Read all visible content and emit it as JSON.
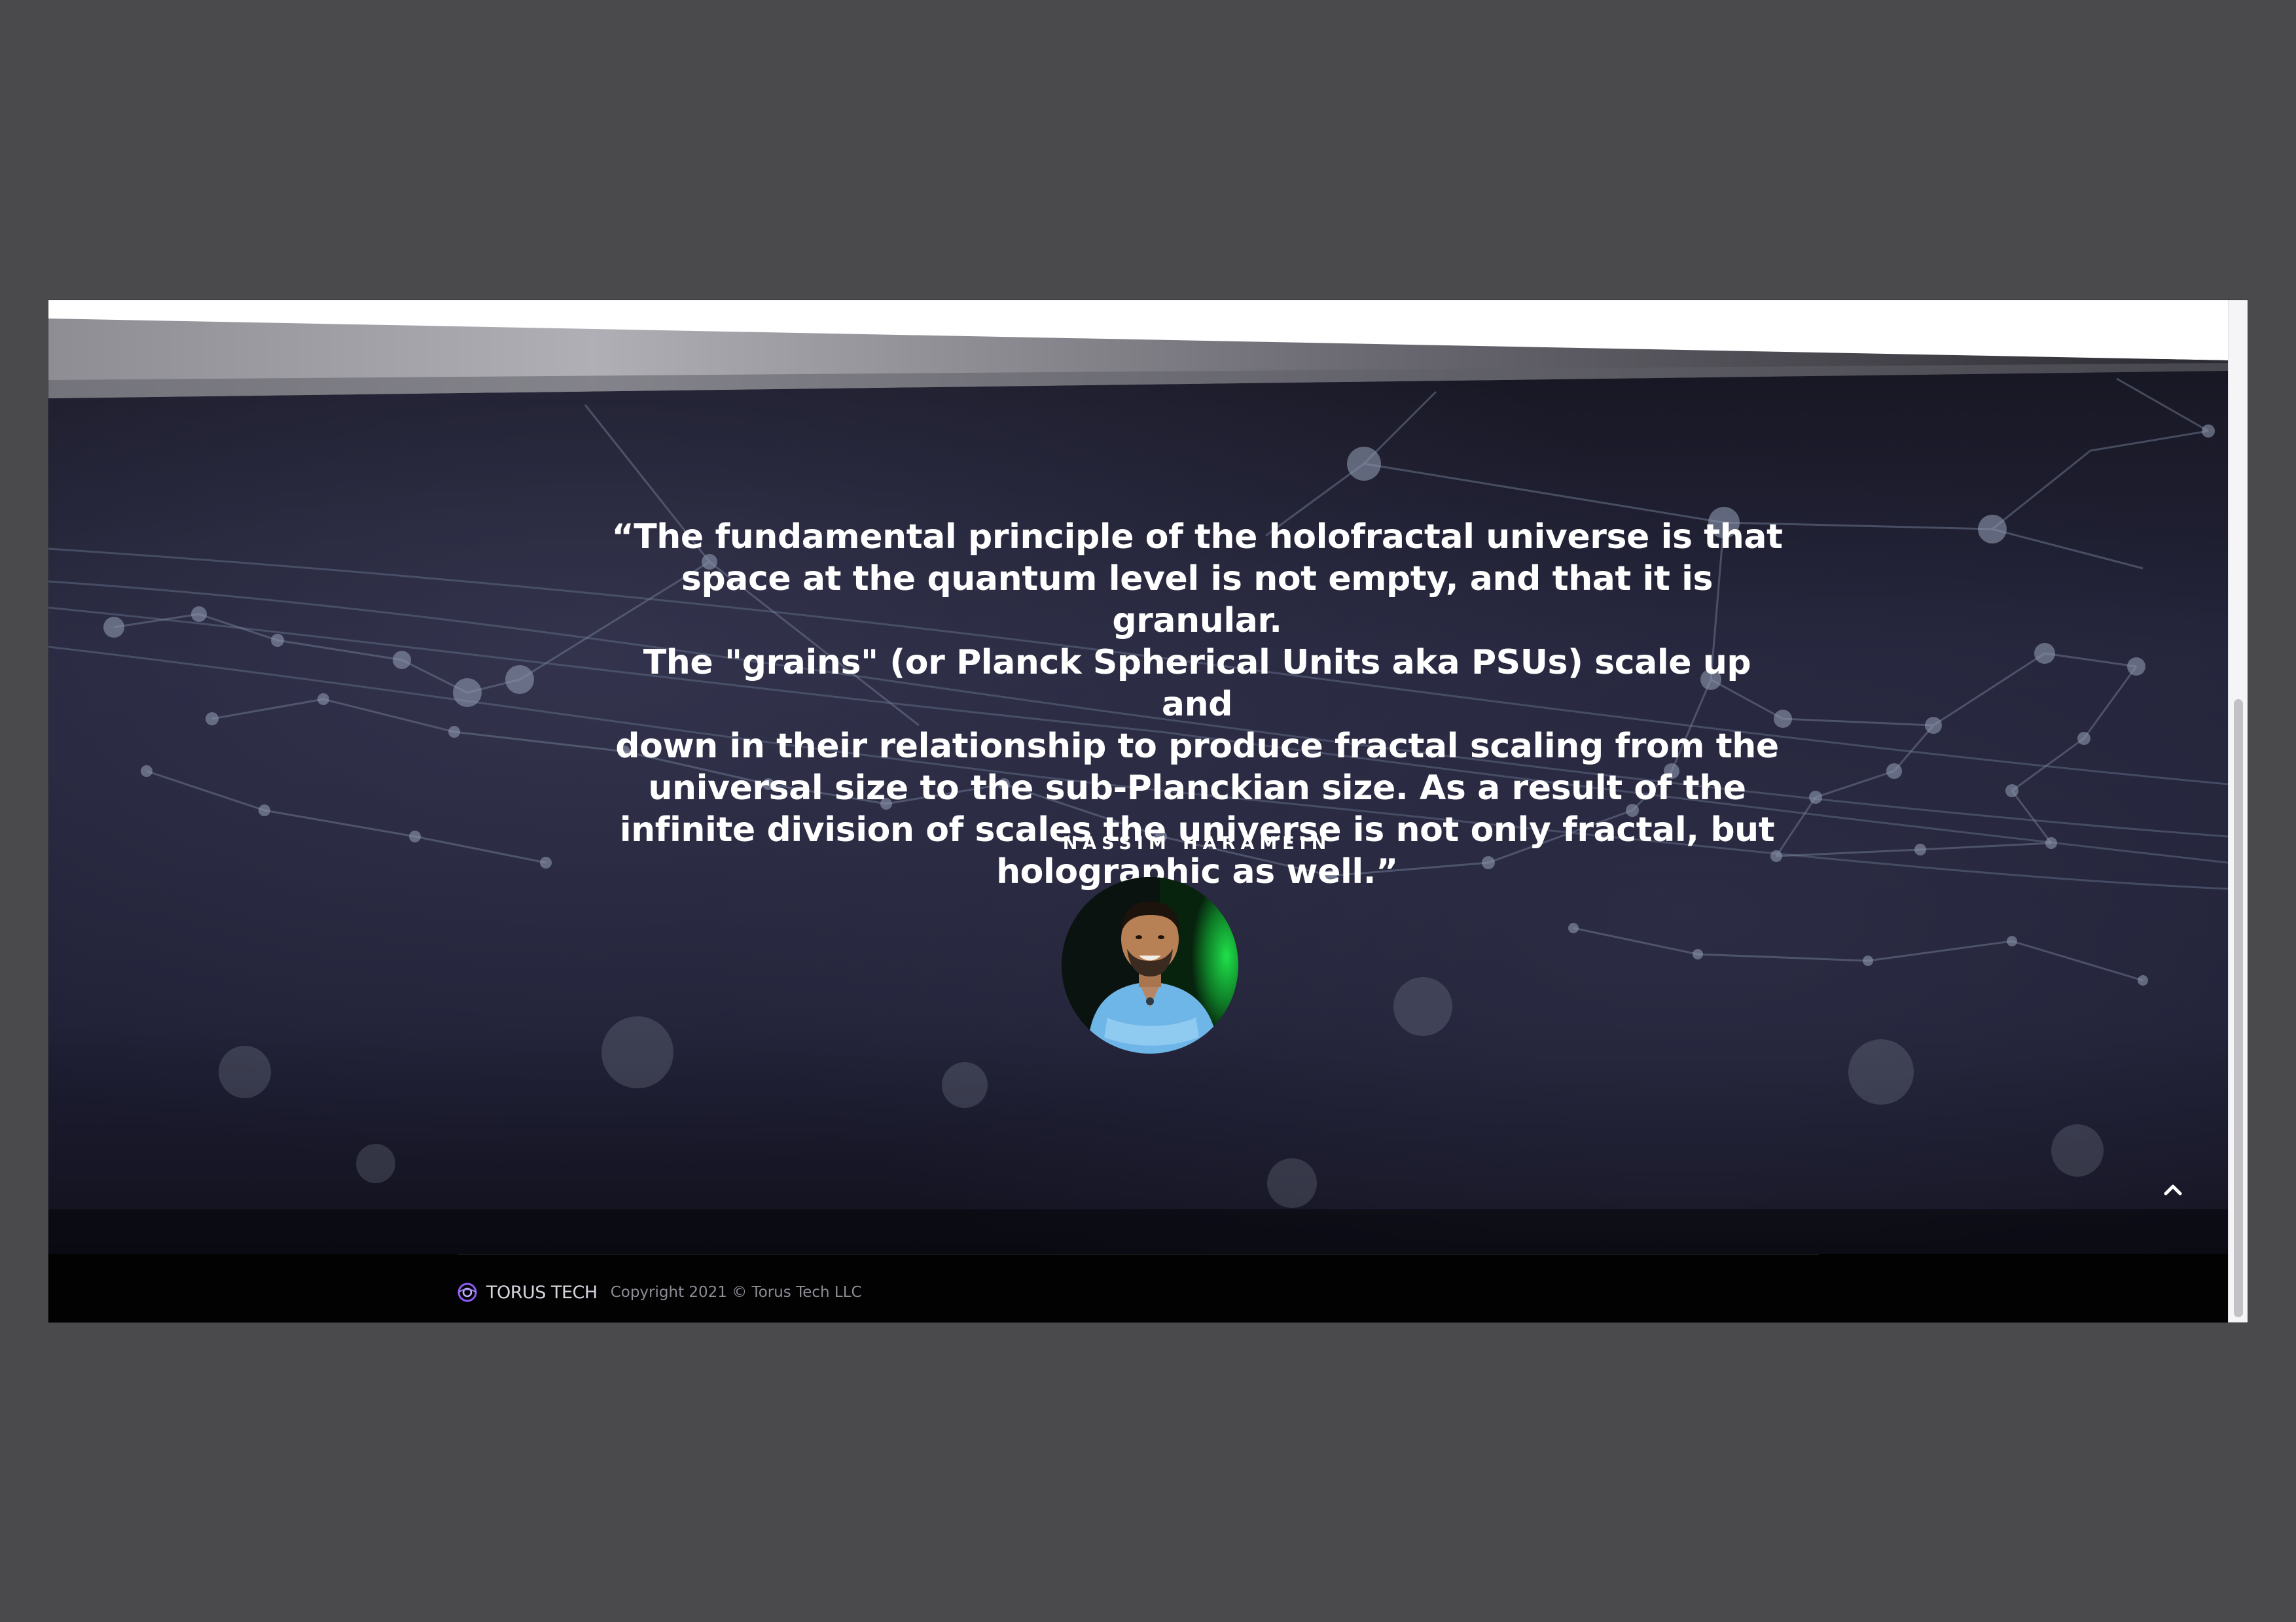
{
  "testimonial": {
    "quote": "“The fundamental principle of the holofractal universe is that\nspace at the quantum level is not empty, and that it is granular.\nThe \"grains\" (or Planck Spherical Units aka PSUs) scale up and\ndown in their relationship to produce fractal scaling from the\nuniversal size to the sub-Planckian size. As a result of the\ninfinite division of scales the universe is not only fractal, but\nholographic as well.”",
    "author": "NASSIM HARAMEIN",
    "avatar_icon": "person-photo"
  },
  "scroll_top": {
    "icon": "chevron-up-icon"
  },
  "footer": {
    "brand_logo_icon": "torus-logo-icon",
    "brand_name": "TORUS TECH",
    "copyright": "Copyright 2021 © Torus Tech LLC"
  },
  "colors": {
    "hero_background": "#1a1a2c",
    "footer_background": "#020203",
    "text": "#ffffff",
    "brand_accent": "#7b4fd6"
  }
}
